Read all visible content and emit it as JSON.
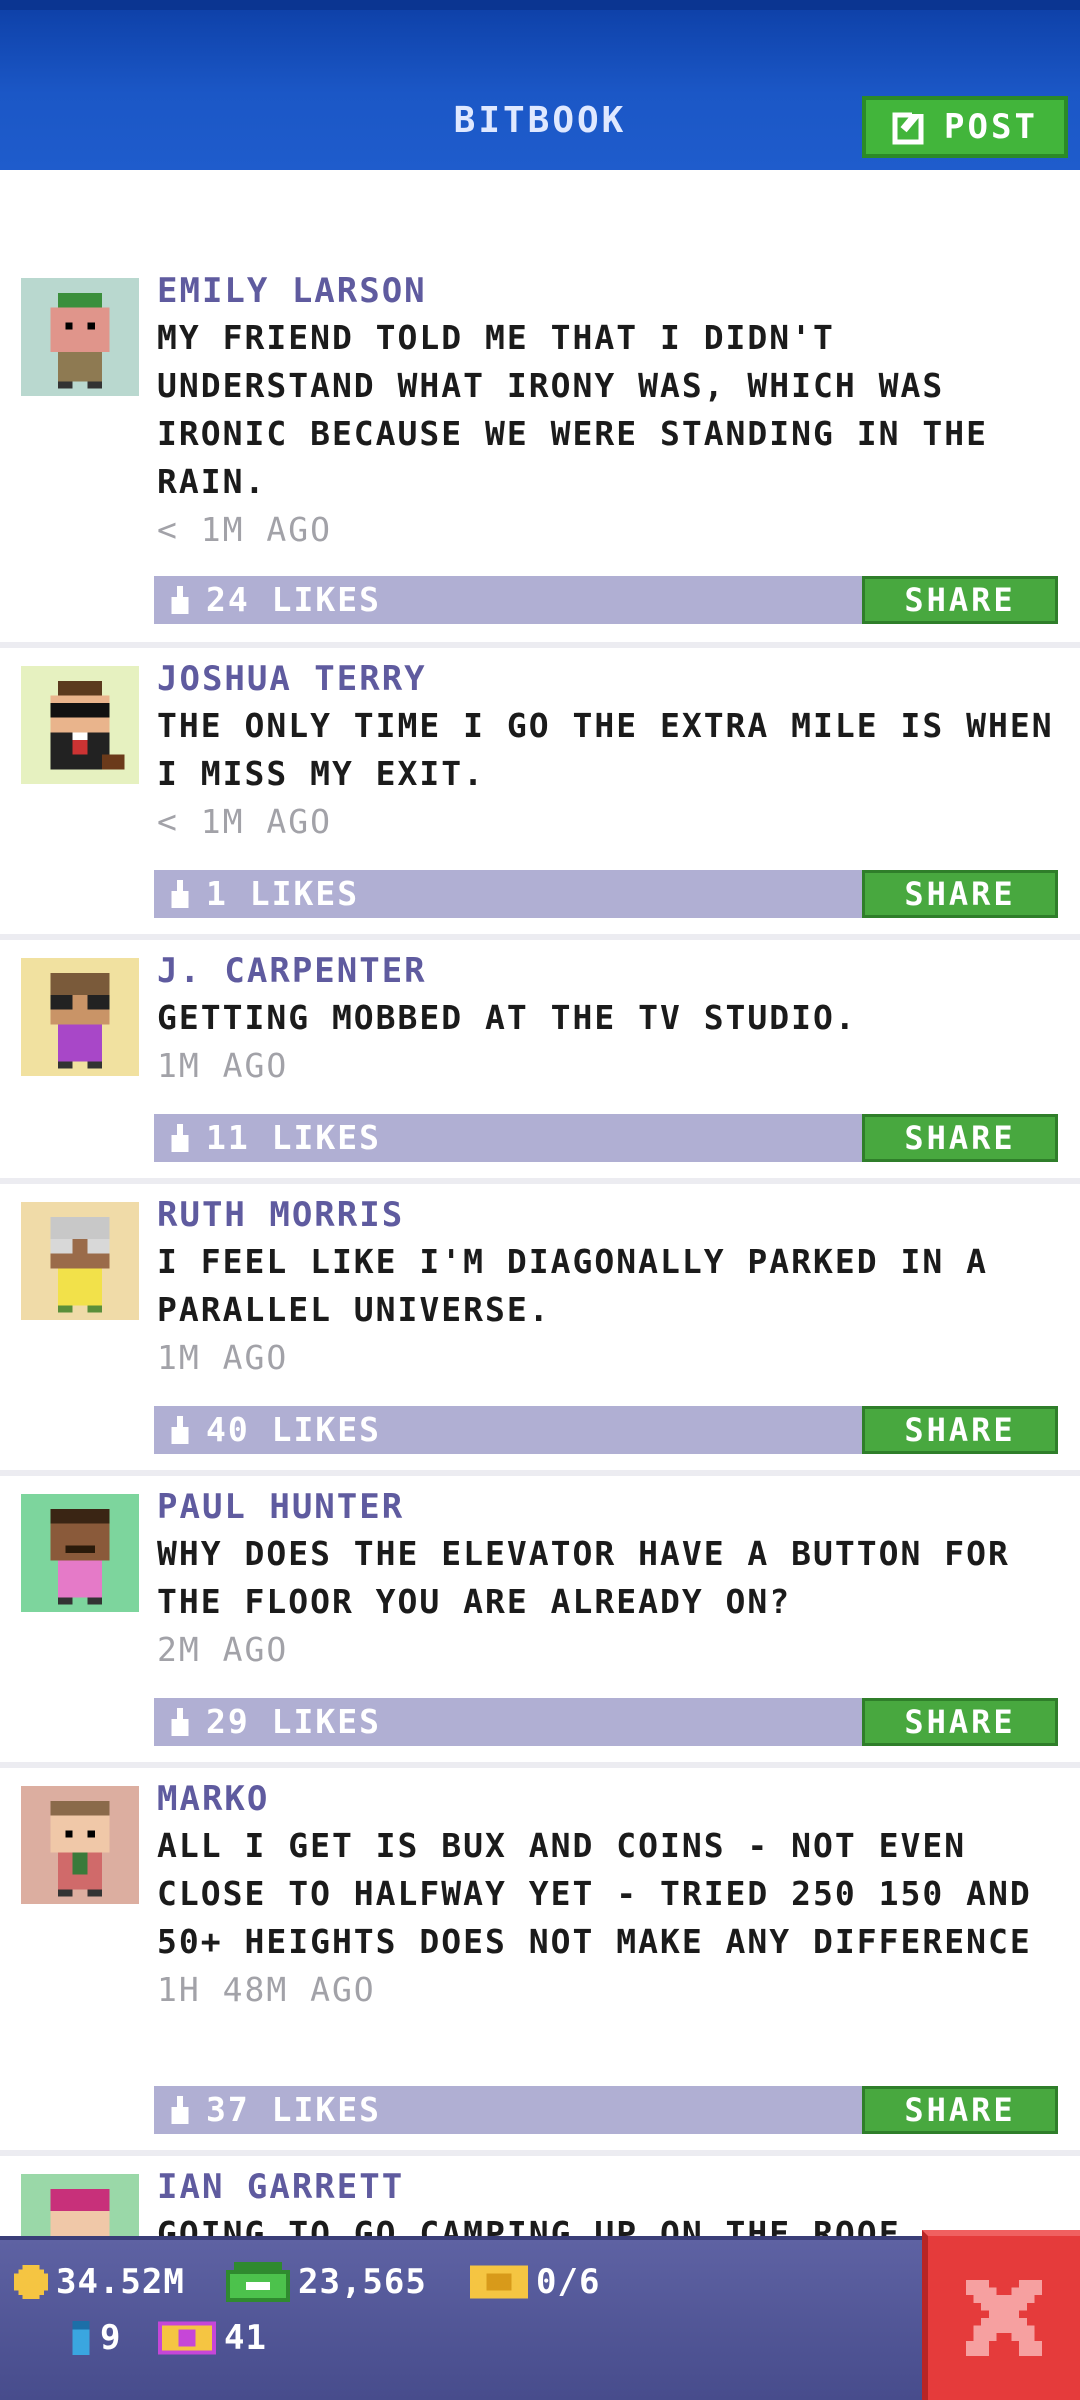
{
  "header": {
    "title": "BITBOOK",
    "post_label": "POST"
  },
  "posts": [
    {
      "name": "EMILY LARSON",
      "text": "MY FRIEND TOLD ME THAT I DIDN'T UNDERSTAND WHAT IRONY WAS, WHICH WAS IRONIC BECAUSE WE WERE STANDING IN THE RAIN.",
      "time": "< 1M AGO",
      "likes": "24 LIKES",
      "share": "SHARE",
      "avatar_bg": "#b9d8cf"
    },
    {
      "name": "JOSHUA TERRY",
      "text": "THE ONLY TIME I GO THE EXTRA MILE IS WHEN I MISS MY EXIT.",
      "time": "< 1M AGO",
      "likes": "1 LIKES",
      "share": "SHARE",
      "avatar_bg": "#e6f1c0"
    },
    {
      "name": "J. CARPENTER",
      "text": "GETTING MOBBED AT THE TV STUDIO.",
      "time": "1M AGO",
      "likes": "11 LIKES",
      "share": "SHARE",
      "avatar_bg": "#f1e1a0"
    },
    {
      "name": "RUTH MORRIS",
      "text": "I FEEL LIKE I'M DIAGONALLY PARKED IN A PARALLEL UNIVERSE.",
      "time": "1M AGO",
      "likes": "40 LIKES",
      "share": "SHARE",
      "avatar_bg": "#f0dba8"
    },
    {
      "name": "PAUL HUNTER",
      "text": "WHY DOES THE ELEVATOR HAVE A BUTTON FOR THE FLOOR YOU ARE ALREADY ON?",
      "time": "2M AGO",
      "likes": "29 LIKES",
      "share": "SHARE",
      "avatar_bg": "#7dd59d"
    },
    {
      "name": "MARKO",
      "text": "ALL I GET IS BUX AND COINS - NOT EVEN CLOSE TO HALFWAY YET - TRIED 250 150 AND 50+ HEIGHTS DOES NOT MAKE ANY DIFFERENCE",
      "time": "1H 48M AGO",
      "likes": "37 LIKES",
      "share": "SHARE",
      "avatar_bg": "#dcaea0"
    },
    {
      "name": "IAN GARRETT",
      "text": "GOING TO GO CAMPING UP ON THE ROOF",
      "time": "",
      "likes": "",
      "share": "",
      "avatar_bg": "#9ad8a8"
    }
  ],
  "status": {
    "coins": "34.52M",
    "bux": "23,565",
    "tickets": "0/6",
    "blue_items": "9",
    "golden_tickets": "41"
  },
  "colors": {
    "header_blue": "#1b57c6",
    "share_green": "#48a83f",
    "like_bar": "#b0afd3",
    "name_purple": "#5f5b9f",
    "close_red": "#e53b3b"
  }
}
